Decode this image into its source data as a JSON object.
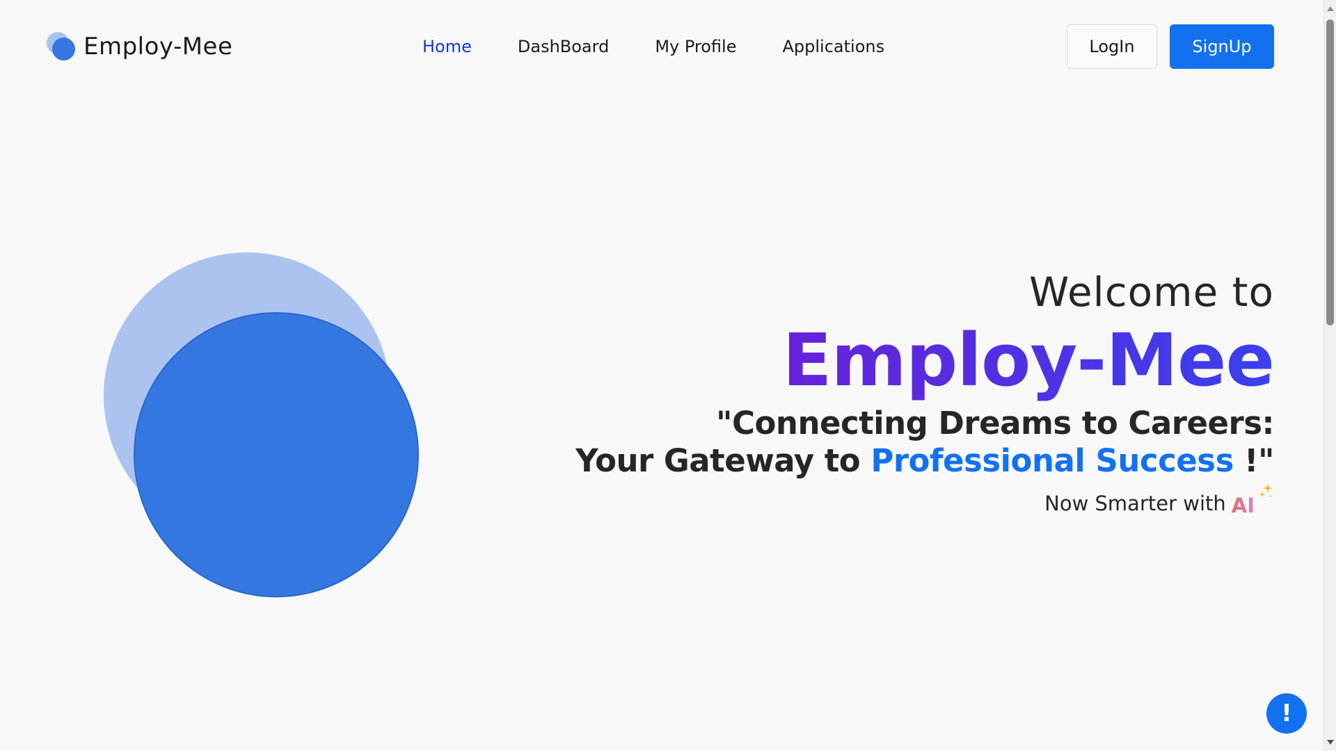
{
  "brand": {
    "name": "Employ-Mee",
    "logo_icon": "overlapping-circles-logo",
    "colors": {
      "primary": "#1371f0",
      "logo_light": "#abc3ee",
      "logo_dark": "#3577e0",
      "nav_active": "#1437d8",
      "gradient_start": "#7a12cc",
      "gradient_end": "#3a40ec"
    }
  },
  "nav": {
    "items": [
      {
        "label": "Home",
        "active": true
      },
      {
        "label": "DashBoard",
        "active": false
      },
      {
        "label": "My Profile",
        "active": false
      },
      {
        "label": "Applications",
        "active": false
      }
    ]
  },
  "auth": {
    "login_label": "LogIn",
    "signup_label": "SignUp"
  },
  "hero": {
    "welcome": "Welcome to",
    "brand_name": "Employ-Mee",
    "tagline_line1": "\"Connecting Dreams to Careers:",
    "tagline_line2_prefix": "Your Gateway to",
    "tagline_highlight": "Professional Success",
    "tagline_suffix": "!\"",
    "ai_prefix": "Now Smarter with",
    "ai_badge": "AI",
    "ai_icon": "sparkle-icon"
  },
  "help": {
    "label": "!",
    "icon": "alert-icon"
  }
}
